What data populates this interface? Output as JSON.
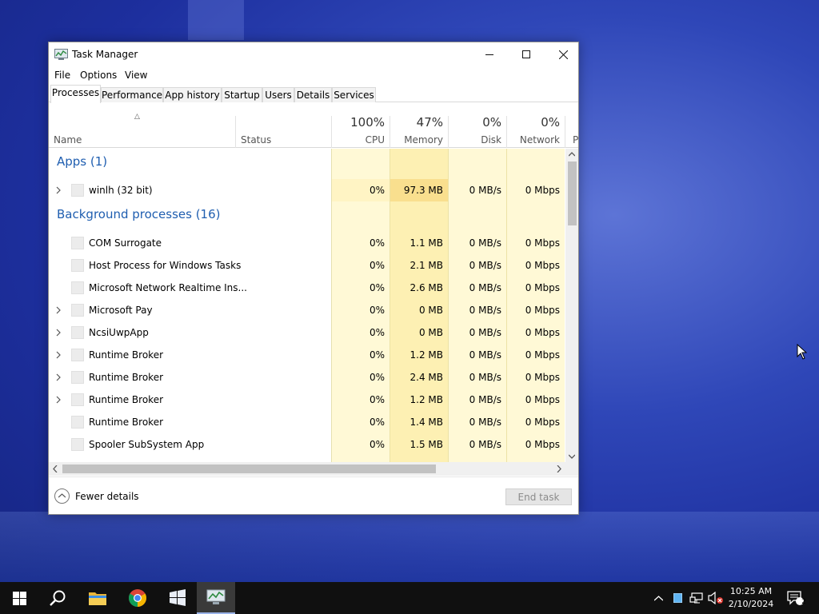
{
  "window": {
    "title": "Task Manager"
  },
  "menu": [
    "File",
    "Options",
    "View"
  ],
  "tabs": [
    "Processes",
    "Performance",
    "App history",
    "Startup",
    "Users",
    "Details",
    "Services"
  ],
  "header": {
    "name": "Name",
    "status": "Status",
    "cpu": {
      "pct": "100%",
      "label": "CPU"
    },
    "memory": {
      "pct": "47%",
      "label": "Memory"
    },
    "disk": {
      "pct": "0%",
      "label": "Disk"
    },
    "network": {
      "pct": "0%",
      "label": "Network"
    },
    "overflow": "P"
  },
  "groups": {
    "apps": "Apps (1)",
    "background": "Background processes (16)"
  },
  "apps": [
    {
      "name": "winlh (32 bit)",
      "cpu": "0%",
      "memory": "97.3 MB",
      "disk": "0 MB/s",
      "network": "0 Mbps",
      "expandable": true
    }
  ],
  "background": [
    {
      "name": "COM Surrogate",
      "cpu": "0%",
      "memory": "1.1 MB",
      "disk": "0 MB/s",
      "network": "0 Mbps",
      "expandable": false
    },
    {
      "name": "Host Process for Windows Tasks",
      "cpu": "0%",
      "memory": "2.1 MB",
      "disk": "0 MB/s",
      "network": "0 Mbps",
      "expandable": false
    },
    {
      "name": "Microsoft Network Realtime Ins...",
      "cpu": "0%",
      "memory": "2.6 MB",
      "disk": "0 MB/s",
      "network": "0 Mbps",
      "expandable": false
    },
    {
      "name": "Microsoft Pay",
      "cpu": "0%",
      "memory": "0 MB",
      "disk": "0 MB/s",
      "network": "0 Mbps",
      "expandable": true
    },
    {
      "name": "NcsiUwpApp",
      "cpu": "0%",
      "memory": "0 MB",
      "disk": "0 MB/s",
      "network": "0 Mbps",
      "expandable": true
    },
    {
      "name": "Runtime Broker",
      "cpu": "0%",
      "memory": "1.2 MB",
      "disk": "0 MB/s",
      "network": "0 Mbps",
      "expandable": true
    },
    {
      "name": "Runtime Broker",
      "cpu": "0%",
      "memory": "2.4 MB",
      "disk": "0 MB/s",
      "network": "0 Mbps",
      "expandable": true
    },
    {
      "name": "Runtime Broker",
      "cpu": "0%",
      "memory": "1.2 MB",
      "disk": "0 MB/s",
      "network": "0 Mbps",
      "expandable": true
    },
    {
      "name": "Runtime Broker",
      "cpu": "0%",
      "memory": "1.4 MB",
      "disk": "0 MB/s",
      "network": "0 Mbps",
      "expandable": false
    },
    {
      "name": "Spooler SubSystem App",
      "cpu": "0%",
      "memory": "1.5 MB",
      "disk": "0 MB/s",
      "network": "0 Mbps",
      "expandable": false
    }
  ],
  "footer": {
    "fewer": "Fewer details",
    "end_task": "End task"
  },
  "taskbar": {
    "apps": [
      "start-icon",
      "search-icon",
      "file-explorer-icon",
      "chrome-icon",
      "winlh-icon",
      "task-manager-icon"
    ],
    "time": "10:25 AM",
    "date": "2/10/2024",
    "notifications": "2"
  },
  "colors": {
    "accent": "#1f5eb0",
    "heat_light": "#fff9d6",
    "heat_mem": "#fdf0b3",
    "heat_mem_hot": "#f9df8e",
    "taskbar": "#101010"
  }
}
